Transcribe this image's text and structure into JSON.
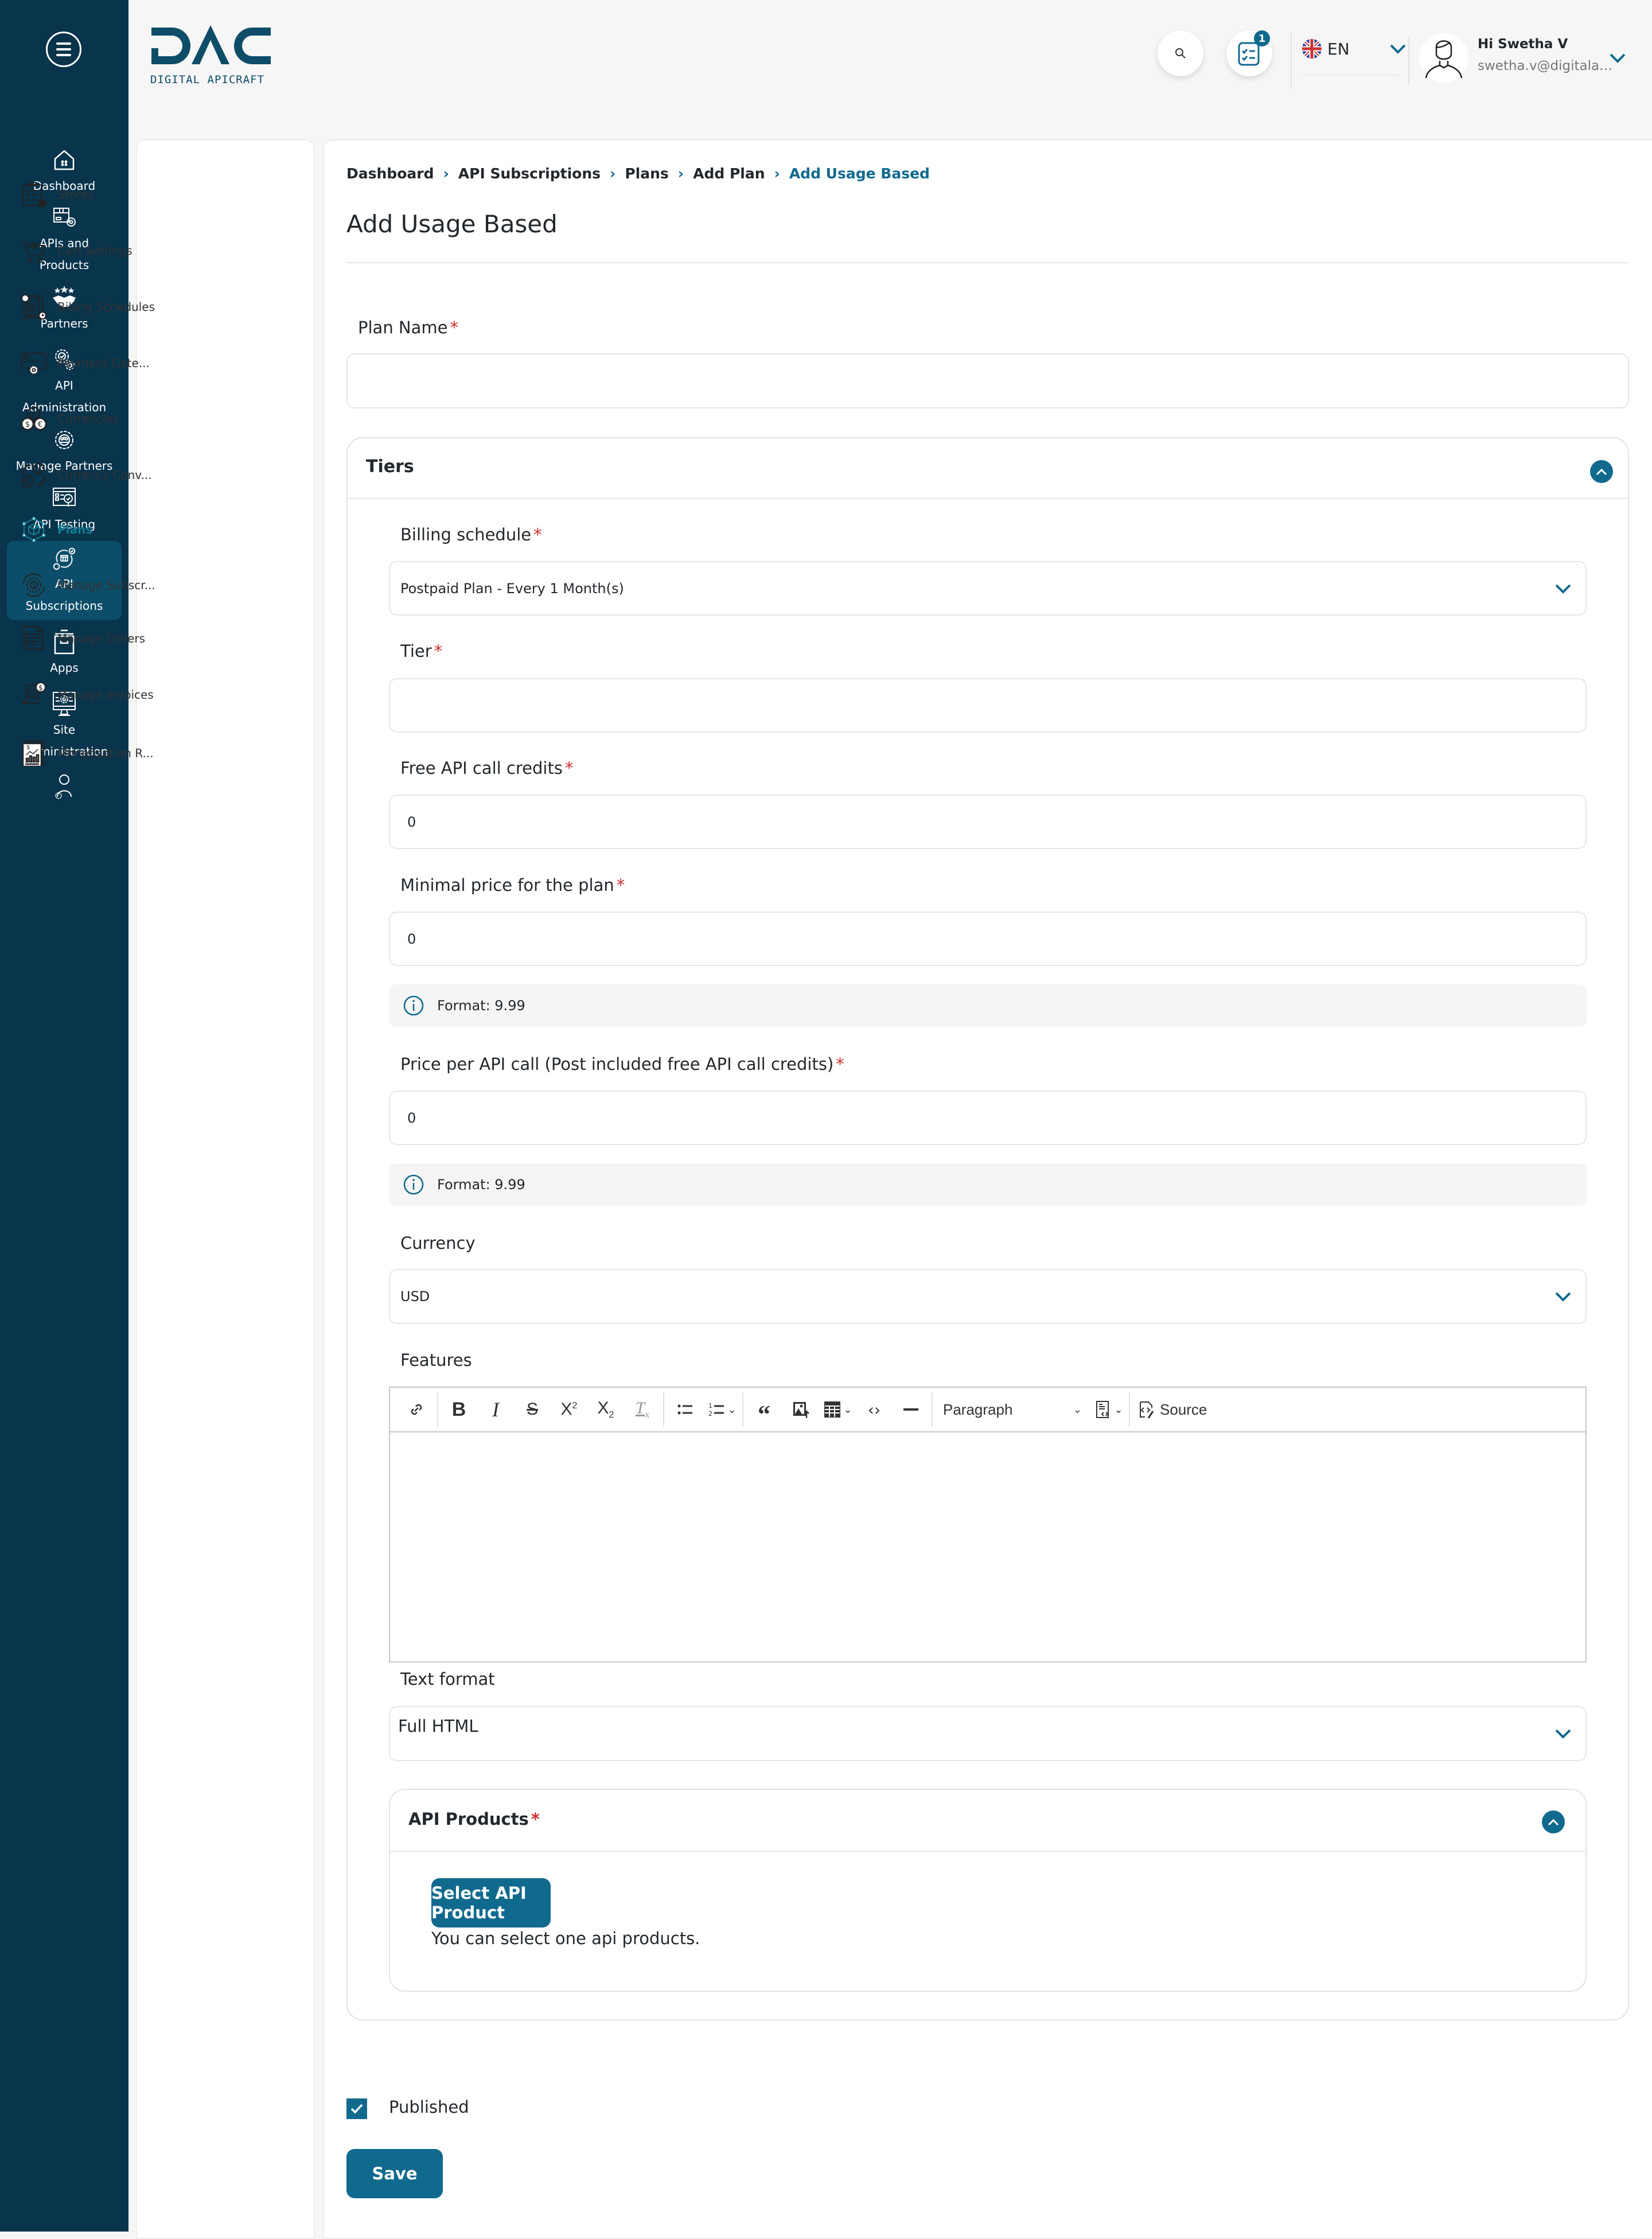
{
  "brand": {
    "logo_text": "DAC",
    "logo_subtitle": "DIGITAL APICRAFT",
    "accent_color": "#106a8e",
    "nav_bg_color": "#08344c"
  },
  "header": {
    "notification_count": "1",
    "language": "EN",
    "user_greeting": "Hi Swetha V",
    "user_email": "swetha.v@digitalapicraft.com"
  },
  "sidebar": {
    "items": [
      {
        "label": "Dashboard",
        "icon": "home-icon"
      },
      {
        "label": "APIs and Products",
        "icon": "package-gear-icon"
      },
      {
        "label": "Partners",
        "icon": "handshake-icon"
      },
      {
        "label": "API Administration",
        "icon": "gears-icon"
      },
      {
        "label": "Manage Partners",
        "icon": "group-gear-icon"
      },
      {
        "label": "API Testing",
        "icon": "testing-window-icon"
      },
      {
        "label": "API Subscriptions",
        "icon": "subscription-cycle-icon",
        "active": true
      },
      {
        "label": "Apps",
        "icon": "archive-box-icon"
      },
      {
        "label": "Site Administration",
        "icon": "monitor-gear-icon"
      },
      {
        "label": "",
        "icon": "user-gear-icon"
      }
    ]
  },
  "subnav": {
    "items": [
      {
        "label": "Stores",
        "icon": "clipboard-check-icon"
      },
      {
        "label": "Cart Settings",
        "icon": "cart-gear-icon"
      },
      {
        "label": "Billing Schedules",
        "icon": "billing-docs-clock-icon"
      },
      {
        "label": "Payment Gate...",
        "icon": "card-gear-icon"
      },
      {
        "label": "Currencies",
        "icon": "coins-icon"
      },
      {
        "label": "Currency Conv...",
        "icon": "currency-exchange-icon"
      },
      {
        "label": "Plans",
        "icon": "box-network-icon",
        "active": true
      },
      {
        "label": "Manage Subscr...",
        "icon": "dollar-gear-cycle-icon"
      },
      {
        "label": "Manage Orders",
        "icon": "order-list-icon"
      },
      {
        "label": "Manage Invoices",
        "icon": "invoice-dollar-icon"
      },
      {
        "label": "Monetization R...",
        "icon": "report-chart-icon"
      }
    ]
  },
  "breadcrumb": {
    "items": [
      "Dashboard",
      "API Subscriptions",
      "Plans",
      "Add Plan"
    ],
    "current": "Add Usage Based"
  },
  "page": {
    "title": "Add Usage Based"
  },
  "form": {
    "plan_name": {
      "label": "Plan Name",
      "value": ""
    },
    "tiers": {
      "title": "Tiers",
      "billing_schedule": {
        "label": "Billing schedule",
        "value": "Postpaid Plan - Every 1 Month(s)"
      },
      "tier": {
        "label": "Tier",
        "value": ""
      },
      "free_api_credits": {
        "label": "Free API call credits",
        "value": "0"
      },
      "minimal_price": {
        "label": "Minimal price for the plan",
        "value": "0",
        "hint": "Format: 9.99"
      },
      "price_per_call": {
        "label": "Price per API call (Post included free API call credits)",
        "value": "0",
        "hint": "Format: 9.99"
      },
      "currency": {
        "label": "Currency",
        "value": "USD"
      },
      "features": {
        "label": "Features",
        "toolbar": {
          "heading_select": "Paragraph",
          "source_label": "Source"
        },
        "content": ""
      },
      "text_format": {
        "label": "Text format",
        "value": "Full HTML"
      },
      "api_products": {
        "title": "API Products",
        "button_label": "Select API Product",
        "helper_text": "You can select one api products."
      }
    },
    "published": {
      "label": "Published",
      "checked": true
    },
    "save_label": "Save",
    "required_marker": "*"
  }
}
